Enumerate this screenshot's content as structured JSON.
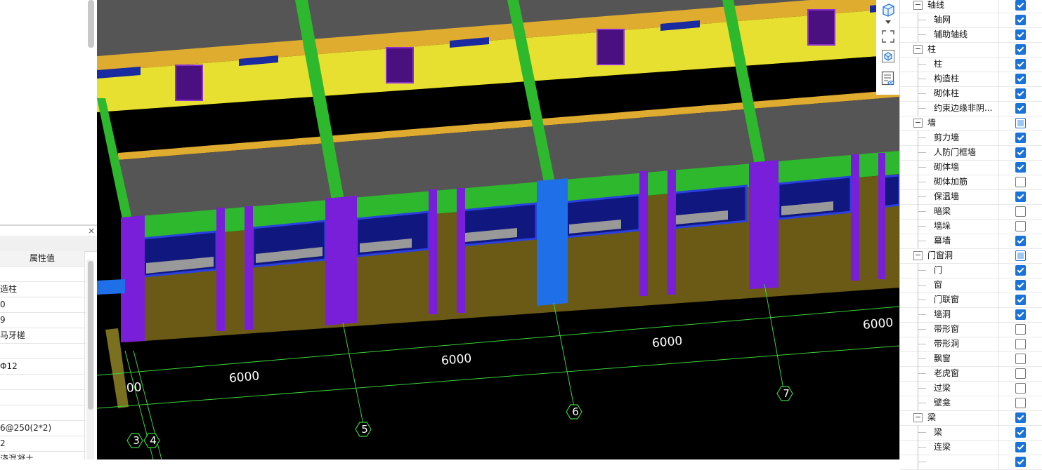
{
  "left_panel": {
    "close_label": "×",
    "column_header": "属性值",
    "rows": [
      "",
      "造柱",
      "0",
      "9",
      "马牙槎",
      "",
      "Φ12",
      "",
      "",
      "",
      "6@250(2*2)",
      "2",
      "浇混凝土"
    ]
  },
  "viewport": {
    "dimension_labels": [
      "6000",
      "6000",
      "6000",
      "6000",
      "00"
    ],
    "axis_labels": [
      "3",
      "4",
      "5",
      "6",
      "7"
    ],
    "tools": [
      "cube-view-icon",
      "dropdown-arrow-icon",
      "fit-view-icon",
      "3d-box-icon",
      "display-settings-icon"
    ]
  },
  "layers": [
    {
      "type": "group",
      "label": "轴线",
      "state": "on",
      "toggle": "−"
    },
    {
      "type": "child",
      "label": "轴网",
      "state": "on"
    },
    {
      "type": "child",
      "label": "辅助轴线",
      "state": "on"
    },
    {
      "type": "group",
      "label": "柱",
      "state": "on",
      "toggle": "−"
    },
    {
      "type": "child",
      "label": "柱",
      "state": "on"
    },
    {
      "type": "child",
      "label": "构造柱",
      "state": "on"
    },
    {
      "type": "child",
      "label": "砌体柱",
      "state": "on"
    },
    {
      "type": "child",
      "label": "约束边缘非阴...",
      "state": "on"
    },
    {
      "type": "group",
      "label": "墙",
      "state": "part",
      "toggle": "−"
    },
    {
      "type": "child",
      "label": "剪力墙",
      "state": "on"
    },
    {
      "type": "child",
      "label": "人防门框墙",
      "state": "on"
    },
    {
      "type": "child",
      "label": "砌体墙",
      "state": "on"
    },
    {
      "type": "child",
      "label": "砌体加筋",
      "state": "off"
    },
    {
      "type": "child",
      "label": "保温墙",
      "state": "on"
    },
    {
      "type": "child",
      "label": "暗梁",
      "state": "off"
    },
    {
      "type": "child",
      "label": "墙垛",
      "state": "off"
    },
    {
      "type": "child",
      "label": "幕墙",
      "state": "on"
    },
    {
      "type": "group",
      "label": "门窗洞",
      "state": "part",
      "toggle": "−"
    },
    {
      "type": "child",
      "label": "门",
      "state": "on"
    },
    {
      "type": "child",
      "label": "窗",
      "state": "on"
    },
    {
      "type": "child",
      "label": "门联窗",
      "state": "on"
    },
    {
      "type": "child",
      "label": "墙洞",
      "state": "on"
    },
    {
      "type": "child",
      "label": "带形窗",
      "state": "off"
    },
    {
      "type": "child",
      "label": "带形洞",
      "state": "off"
    },
    {
      "type": "child",
      "label": "飘窗",
      "state": "off"
    },
    {
      "type": "child",
      "label": "老虎窗",
      "state": "off"
    },
    {
      "type": "child",
      "label": "过梁",
      "state": "off"
    },
    {
      "type": "child",
      "label": "壁龛",
      "state": "off"
    },
    {
      "type": "group",
      "label": "梁",
      "state": "on",
      "toggle": "−"
    },
    {
      "type": "child",
      "label": "梁",
      "state": "on"
    },
    {
      "type": "child",
      "label": "连梁",
      "state": "on"
    },
    {
      "type": "child",
      "label": "",
      "state": "on"
    }
  ],
  "colors": {
    "slab": "#555555",
    "beam_green": "#2db82d",
    "column_purple": "#7a1fd9",
    "column_blue": "#1f6fe8",
    "wall_olive": "#6b5a16",
    "wall_yellow": "#e8e030",
    "beam_orange": "#e0ac30",
    "window_navy": "#101880",
    "dim_green": "#3ad23a",
    "checkbox_blue": "#1a73d9"
  }
}
